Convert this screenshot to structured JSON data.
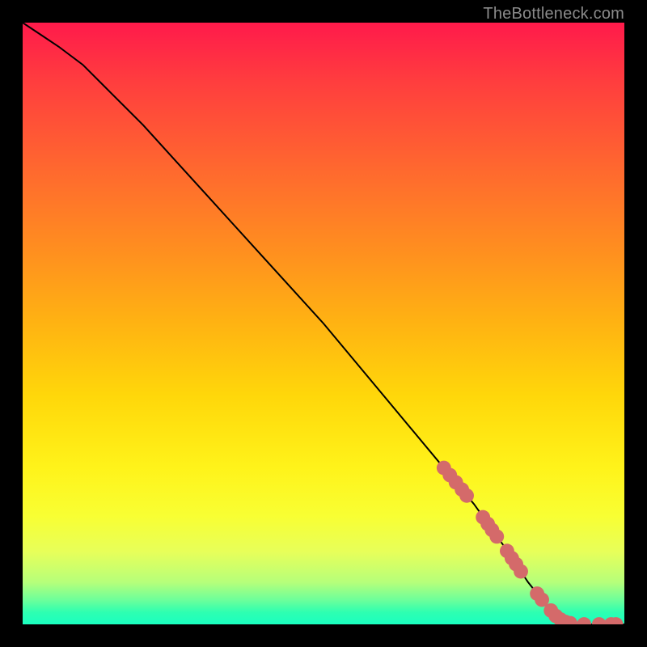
{
  "watermark": "TheBottleneck.com",
  "chart_data": {
    "type": "line",
    "title": "",
    "xlabel": "",
    "ylabel": "",
    "xlim": [
      0,
      100
    ],
    "ylim": [
      0,
      100
    ],
    "grid": false,
    "annotations": [],
    "curve": {
      "x": [
        0,
        3,
        6,
        10,
        15,
        20,
        25,
        30,
        35,
        40,
        45,
        50,
        55,
        60,
        65,
        70,
        75,
        80,
        82,
        84,
        86,
        88,
        90,
        92,
        94,
        96,
        98,
        100
      ],
      "y": [
        100,
        98,
        96,
        93,
        88,
        83,
        77.5,
        72,
        66.5,
        61,
        55.5,
        50,
        44,
        38,
        32,
        26,
        20,
        13,
        10,
        7,
        4.5,
        2,
        0.8,
        0.2,
        0,
        0,
        0,
        0
      ]
    },
    "dots": {
      "color": "#d46a6a",
      "radius_pct": 1.2,
      "points": [
        {
          "x": 70.0,
          "y": 26.0
        },
        {
          "x": 71.0,
          "y": 24.8
        },
        {
          "x": 72.0,
          "y": 23.6
        },
        {
          "x": 73.0,
          "y": 22.4
        },
        {
          "x": 73.8,
          "y": 21.4
        },
        {
          "x": 76.5,
          "y": 17.8
        },
        {
          "x": 77.3,
          "y": 16.7
        },
        {
          "x": 78.0,
          "y": 15.7
        },
        {
          "x": 78.8,
          "y": 14.6
        },
        {
          "x": 80.5,
          "y": 12.2
        },
        {
          "x": 81.3,
          "y": 11.0
        },
        {
          "x": 82.0,
          "y": 10.0
        },
        {
          "x": 82.8,
          "y": 8.8
        },
        {
          "x": 85.5,
          "y": 5.1
        },
        {
          "x": 86.3,
          "y": 4.1
        },
        {
          "x": 87.8,
          "y": 2.3
        },
        {
          "x": 88.6,
          "y": 1.4
        },
        {
          "x": 89.4,
          "y": 0.8
        },
        {
          "x": 90.2,
          "y": 0.4
        },
        {
          "x": 91.0,
          "y": 0.2
        },
        {
          "x": 93.3,
          "y": 0.0
        },
        {
          "x": 95.8,
          "y": 0.0
        },
        {
          "x": 97.8,
          "y": 0.0
        },
        {
          "x": 98.6,
          "y": 0.0
        }
      ]
    }
  }
}
